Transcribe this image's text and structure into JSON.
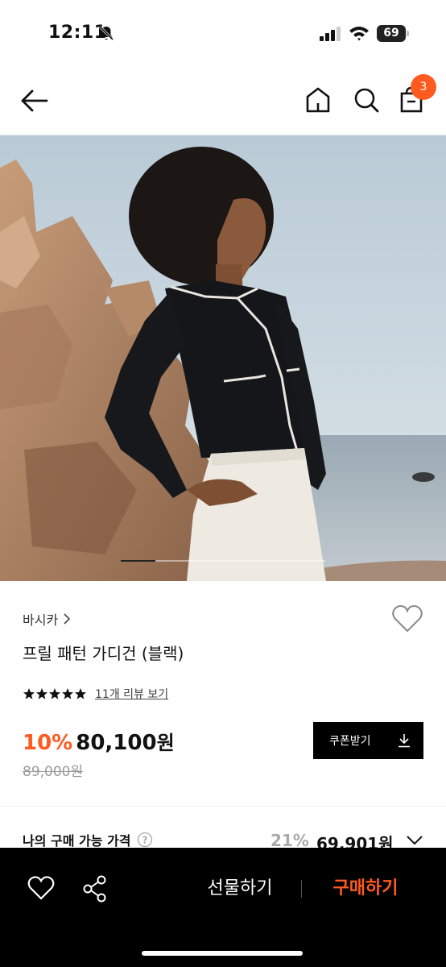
{
  "status_bar": {
    "time": "12:11",
    "battery": "69"
  },
  "nav": {
    "cart_count": "3"
  },
  "hero": {
    "progress": 0.17
  },
  "product": {
    "brand": "바시카",
    "name": "프릴 패턴 가디건 (블랙)",
    "rating": 5,
    "review_link": "11개 리뷰 보기",
    "discount": "10%",
    "price": "80,100",
    "price_unit": "원",
    "original_price": "89,000원",
    "coupon_label": "쿠폰받기"
  },
  "my_price": {
    "label": "나의 구매 가능 가격",
    "discount": "21%",
    "price": "69,901원"
  },
  "bottom_bar": {
    "gift_label": "선물하기",
    "buy_label": "구매하기"
  },
  "colors": {
    "accent": "#ff5a1f",
    "dark": "#000000"
  },
  "icons": [
    "back-arrow-icon",
    "home-icon",
    "search-icon",
    "bag-icon",
    "heart-icon",
    "share-icon",
    "download-icon",
    "help-icon",
    "chevron-down-icon",
    "star-icon"
  ]
}
